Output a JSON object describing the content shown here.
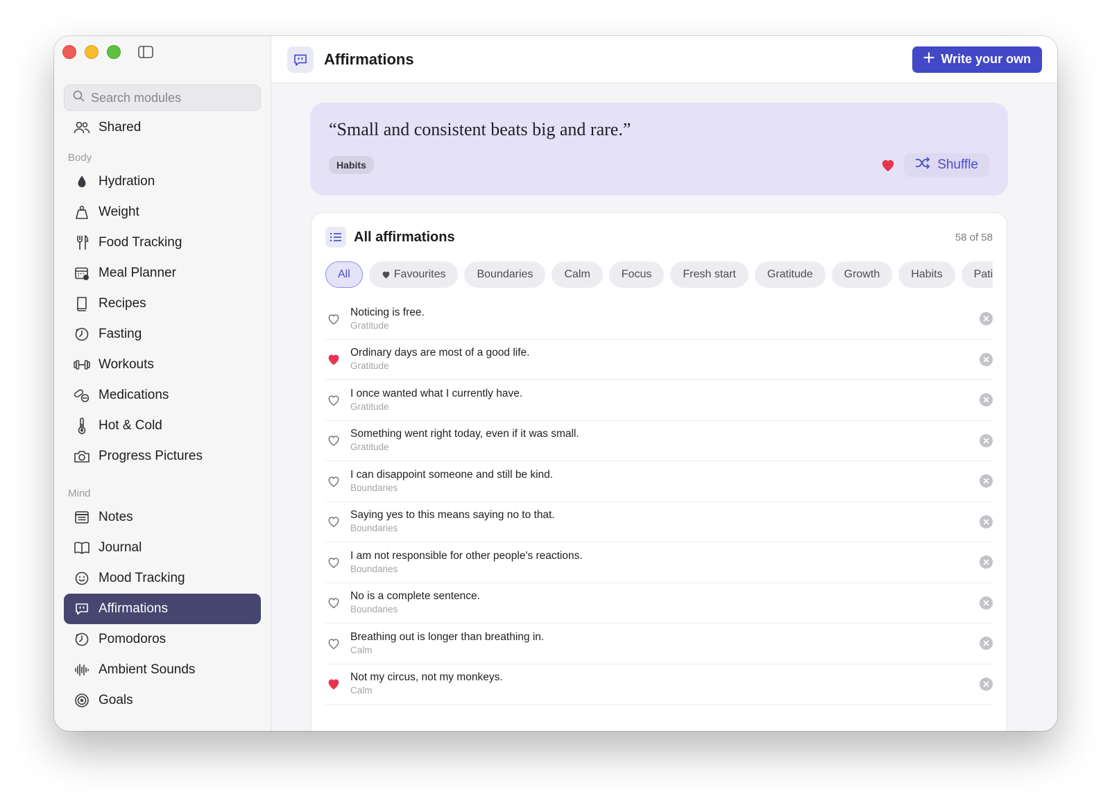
{
  "sidebar": {
    "search_placeholder": "Search modules",
    "shared_label": "Shared",
    "sections": {
      "body": "Body",
      "mind": "Mind"
    },
    "body_items": [
      {
        "label": "Hydration",
        "icon": "drop-icon"
      },
      {
        "label": "Weight",
        "icon": "weight-icon"
      },
      {
        "label": "Food Tracking",
        "icon": "fork-knife-icon"
      },
      {
        "label": "Meal Planner",
        "icon": "calendar-icon"
      },
      {
        "label": "Recipes",
        "icon": "book-icon"
      },
      {
        "label": "Fasting",
        "icon": "timer-icon"
      },
      {
        "label": "Workouts",
        "icon": "dumbbell-icon"
      },
      {
        "label": "Medications",
        "icon": "pills-icon"
      },
      {
        "label": "Hot & Cold",
        "icon": "thermometer-icon"
      },
      {
        "label": "Progress Pictures",
        "icon": "camera-icon"
      }
    ],
    "mind_items": [
      {
        "label": "Notes",
        "icon": "notes-icon"
      },
      {
        "label": "Journal",
        "icon": "open-book-icon"
      },
      {
        "label": "Mood Tracking",
        "icon": "smiley-icon"
      },
      {
        "label": "Affirmations",
        "icon": "quote-bubble-icon",
        "active": true
      },
      {
        "label": "Pomodoros",
        "icon": "timer-icon"
      },
      {
        "label": "Ambient Sounds",
        "icon": "waveform-icon"
      },
      {
        "label": "Goals",
        "icon": "target-icon"
      }
    ]
  },
  "header": {
    "title": "Affirmations",
    "write_button": "Write your own"
  },
  "hero": {
    "quote": "“Small and consistent beats big and rare.”",
    "tag": "Habits",
    "favourited": true,
    "shuffle_label": "Shuffle"
  },
  "list": {
    "title": "All affirmations",
    "count": "58 of 58",
    "filters": [
      "All",
      "Favourites",
      "Boundaries",
      "Calm",
      "Focus",
      "Fresh start",
      "Gratitude",
      "Growth",
      "Habits",
      "Pati"
    ],
    "active_filter": "All",
    "rows": [
      {
        "text": "Noticing is free.",
        "category": "Gratitude",
        "favourite": false
      },
      {
        "text": "Ordinary days are most of a good life.",
        "category": "Gratitude",
        "favourite": true
      },
      {
        "text": "I once wanted what I currently have.",
        "category": "Gratitude",
        "favourite": false
      },
      {
        "text": "Something went right today, even if it was small.",
        "category": "Gratitude",
        "favourite": false
      },
      {
        "text": "I can disappoint someone and still be kind.",
        "category": "Boundaries",
        "favourite": false
      },
      {
        "text": "Saying yes to this means saying no to that.",
        "category": "Boundaries",
        "favourite": false
      },
      {
        "text": "I am not responsible for other people's reactions.",
        "category": "Boundaries",
        "favourite": false
      },
      {
        "text": "No is a complete sentence.",
        "category": "Boundaries",
        "favourite": false
      },
      {
        "text": "Breathing out is longer than breathing in.",
        "category": "Calm",
        "favourite": false
      },
      {
        "text": "Not my circus, not my monkeys.",
        "category": "Calm",
        "favourite": true
      }
    ]
  },
  "colors": {
    "accent": "#4248c6",
    "active_nav": "#464670",
    "heart": "#e8344e",
    "hero_bg": "#e5e1f7"
  }
}
